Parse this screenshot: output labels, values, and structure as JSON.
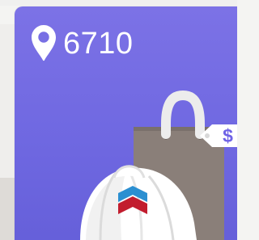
{
  "location": {
    "code": "6710",
    "icon": "location-pin-icon"
  },
  "price_tag": {
    "symbol": "$",
    "icon": "price-tag-icon"
  },
  "illustration": {
    "bag_icon": "shopping-bag-icon",
    "helmet_icon": "hard-hat-icon",
    "logo_icon": "chevron-logo-icon"
  },
  "colors": {
    "card_top": "#7c72e6",
    "card_bottom": "#655fd9",
    "bag": "#8a7f79",
    "bag_handle": "#ececec",
    "helmet": "#ffffff",
    "accent_blue": "#2b8fd1",
    "accent_red": "#c21d2e",
    "tag_symbol": "#6f63e6"
  }
}
